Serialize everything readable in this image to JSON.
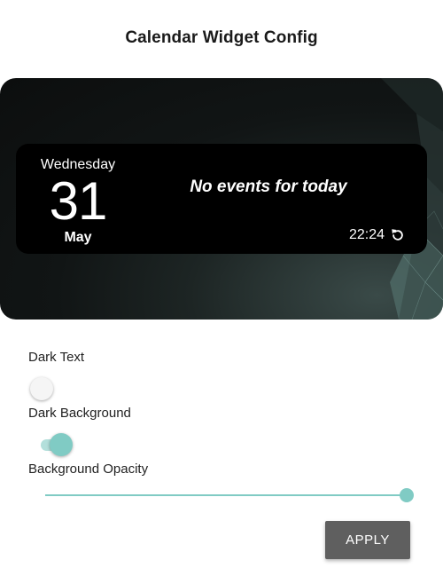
{
  "app": {
    "title": "Calendar Widget Config"
  },
  "preview": {
    "weekday": "Wednesday",
    "day": "31",
    "month": "May",
    "no_events": "No events for today",
    "time": "22:24",
    "refresh_icon": "refresh-icon"
  },
  "settings": {
    "dark_text": {
      "label": "Dark Text",
      "enabled": false
    },
    "dark_background": {
      "label": "Dark Background",
      "enabled": true
    },
    "background_opacity": {
      "label": "Background Opacity",
      "value": 1.0
    }
  },
  "actions": {
    "apply_label": "APPLY"
  },
  "colors": {
    "accent": "#80cbc4",
    "accent_track": "#b3dfdb",
    "button_bg": "#5f5f5f",
    "widget_bg": "#000000"
  }
}
